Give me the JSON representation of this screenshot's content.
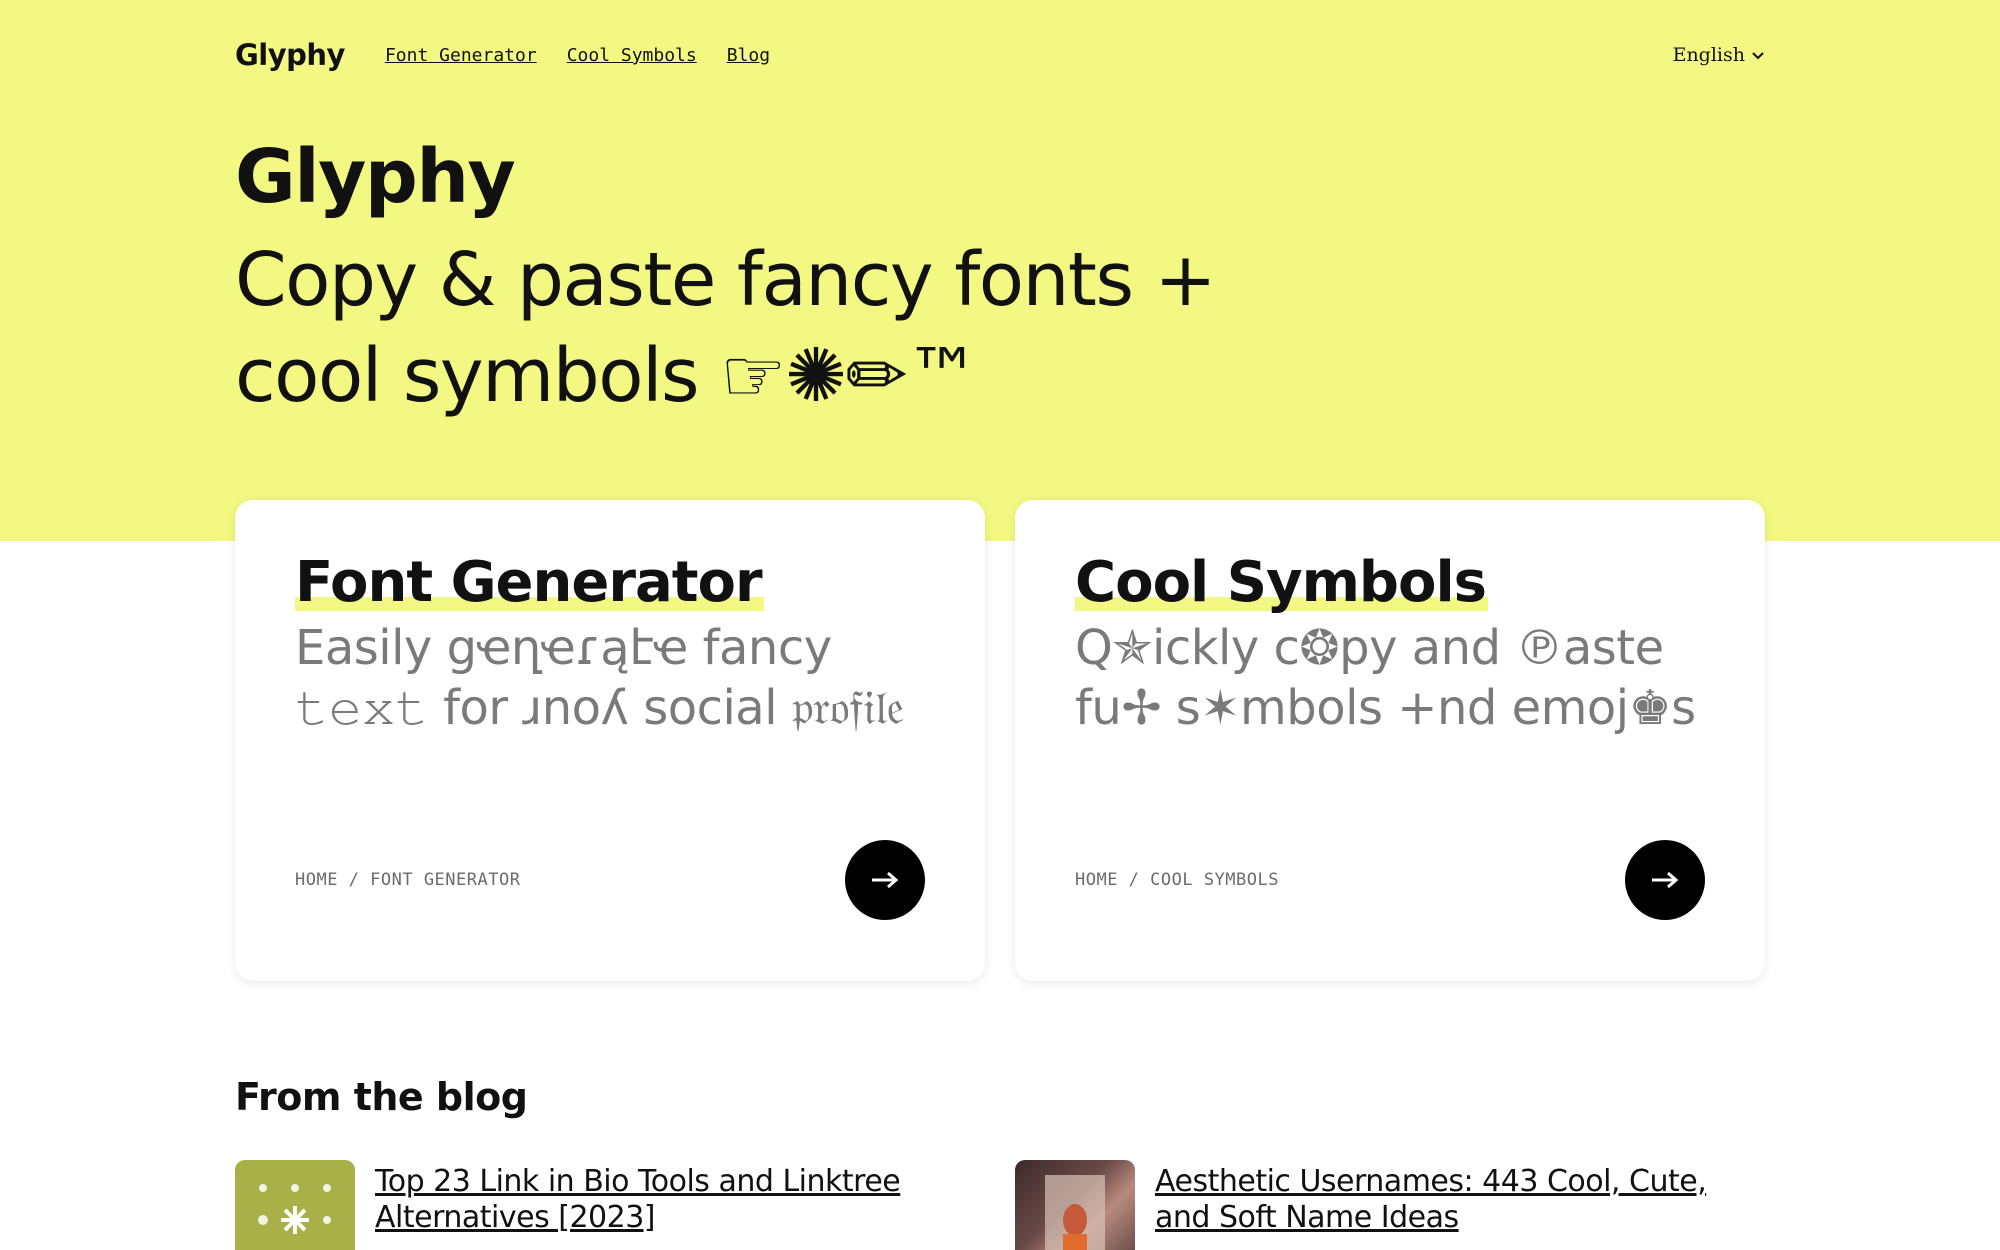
{
  "nav": {
    "logo": "Glyphy",
    "links": [
      "Font Generator",
      "Cool Symbols",
      "Blog"
    ],
    "language": "English"
  },
  "hero": {
    "title": "Glyphy",
    "subtitle_line1": "Copy & paste fancy fonts +",
    "subtitle_line2": "cool symbols ☞✺✏™"
  },
  "cards": [
    {
      "title": "Font Generator",
      "description": "Easily ցҽղҽɾąէҽ fancy 𝚝𝚎𝚡𝚝 for ɹnoʎ social 𝔭𝔯𝔬𝔣𝔦𝔩𝔢",
      "breadcrumb": "HOME / FONT GENERATOR"
    },
    {
      "title": "Cool Symbols",
      "description": "Q✯ickly c❂py and ℗aste fu✢ s✶mbols +nd emoj♚s",
      "breadcrumb": "HOME / COOL SYMBOLS"
    }
  ],
  "blog": {
    "heading": "From the blog",
    "posts": [
      {
        "title": "Top 23 Link in Bio Tools and Linktree Alternatives [2023]"
      },
      {
        "title": "Aesthetic Usernames: 443 Cool, Cute, and Soft Name Ideas"
      }
    ]
  },
  "colors": {
    "accent": "#f2f881",
    "text": "#111111",
    "muted": "#7a7a7a"
  }
}
